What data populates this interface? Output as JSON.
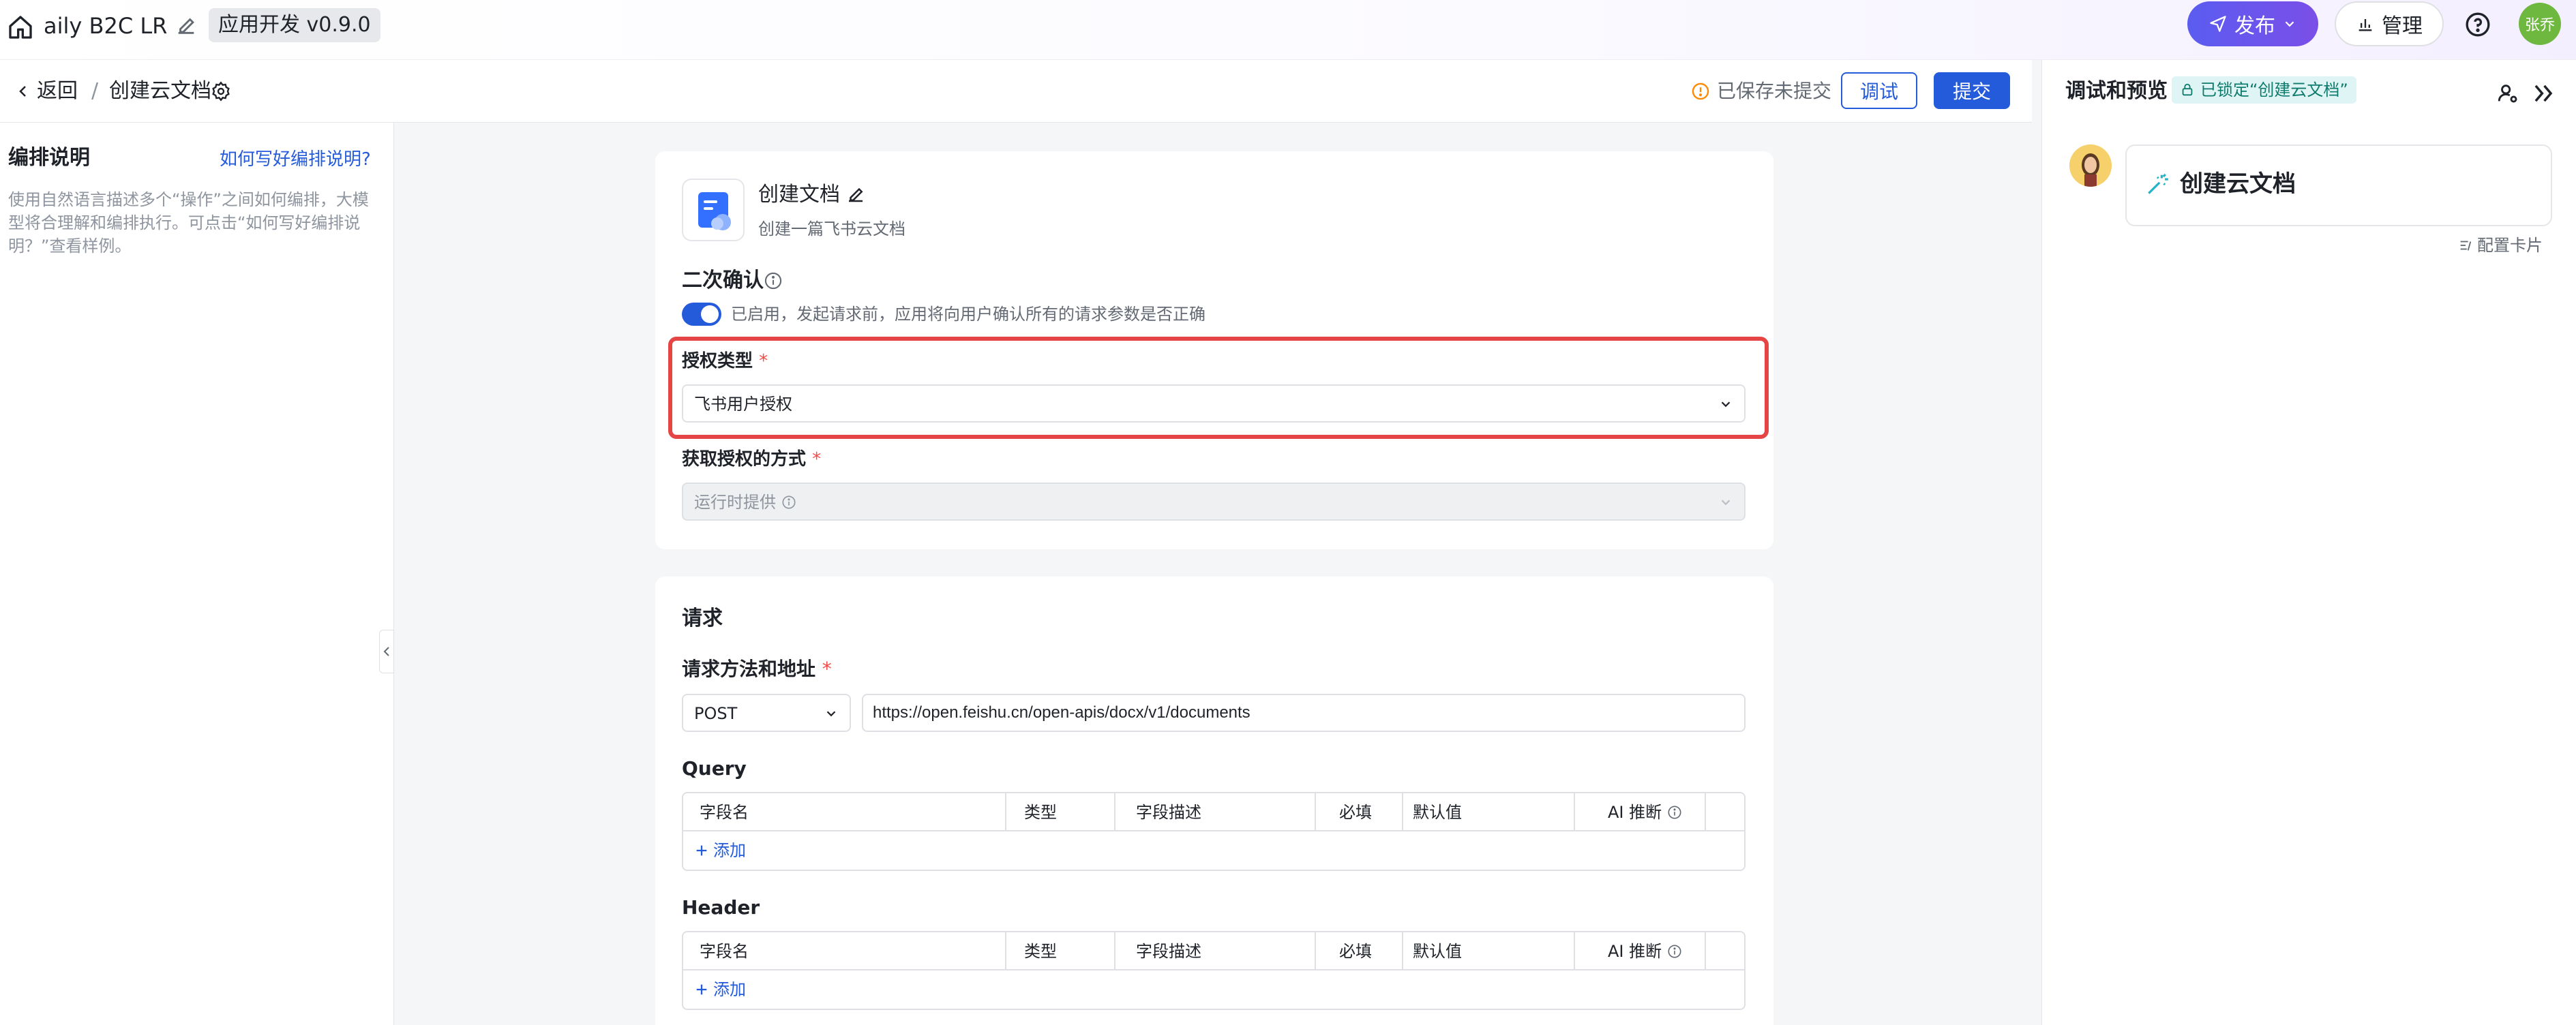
{
  "header": {
    "app_title": "aily B2C LR",
    "version": "应用开发 v0.9.0",
    "publish_label": "发布",
    "manage_label": "管理",
    "user_avatar": "张乔"
  },
  "subheader": {
    "back_label": "返回",
    "separator": "/",
    "page_title": "创建云文档",
    "saved_status": "已保存未提交",
    "debug_label": "调试",
    "submit_label": "提交"
  },
  "sidebar": {
    "title": "编排说明",
    "help_link": "如何写好编排说明?",
    "description": "使用自然语言描述多个“操作”之间如何编排，大模型将合理解和编排执行。可点击“如何写好编排说明？”查看样例。"
  },
  "tool": {
    "name": "创建文档",
    "description": "创建一篇飞书云文档",
    "confirm_label": "二次确认",
    "confirm_enabled": true,
    "confirm_text": "已启用，发起请求前，应用将向用户确认所有的请求参数是否正确",
    "auth_type_label": "授权类型",
    "auth_type_value": "飞书用户授权",
    "auth_method_label": "获取授权的方式",
    "auth_method_value": "运行时提供",
    "required_mark": "*"
  },
  "request": {
    "section_title": "请求",
    "method_url_label": "请求方法和地址",
    "method": "POST",
    "url": "https://open.feishu.cn/open-apis/docx/v1/documents",
    "query_title": "Query",
    "header_title": "Header",
    "columns": [
      "字段名",
      "类型",
      "字段描述",
      "必填",
      "默认值",
      "AI 推断"
    ],
    "add_label": "添加"
  },
  "preview": {
    "title": "调试和预览",
    "lock_badge": "已锁定“创建云文档”",
    "message": "创建云文档",
    "config_card": "配置卡片"
  },
  "colors": {
    "primary": "#245bdb",
    "publish_gradient_start": "#5b5cf0",
    "highlight": "#e54545",
    "required": "#f54a45"
  }
}
